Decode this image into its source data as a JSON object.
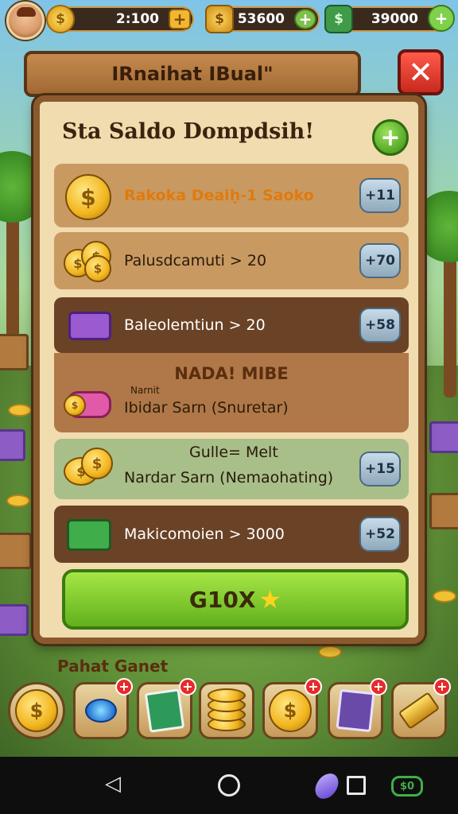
{
  "topbar": {
    "coins_value": "2:100",
    "coins_icon": "coin-icon",
    "gold_value": "53600",
    "gold_icon": "gold-bag-icon",
    "cash_value": "39000",
    "cash_icon": "cash-icon"
  },
  "dialog": {
    "title": "IRnaihat IBual\"",
    "close_label": "✕",
    "heading": "Sta Saldo Dompdsih!",
    "add_label": "+",
    "items": [
      {
        "label": "Rakoka Deaiḥ-1 Saoko",
        "badge": "+11",
        "icon": "coin-icon"
      },
      {
        "label": "Palusdcamuti  >  20",
        "badge": "+70",
        "icon": "coin-stack-icon"
      },
      {
        "label": "Baleolemtiun  >  20",
        "badge": "+58",
        "icon": "chest-icon"
      },
      {
        "label": "Ibidar Sarn (Snuretar)",
        "badge": "",
        "icon": "gift-roll-icon",
        "header": "NADA! MIBE",
        "sub": "Narnit"
      },
      {
        "label": "Nardar Sarn (Nemaohating)",
        "badge": "+15",
        "icon": "coin-pile-icon",
        "header": "Gulle= Melt"
      },
      {
        "label": "Makicomoien  >  3000",
        "badge": "+52",
        "icon": "cash-box-icon"
      }
    ],
    "confirm_label": "G10X",
    "confirm_icon": "star-icon"
  },
  "bottom": {
    "label": "Pahat Ganet",
    "tray": [
      {
        "icon": "coin-icon",
        "badge": ""
      },
      {
        "icon": "blue-crystal-icon",
        "badge": "+"
      },
      {
        "icon": "card-icon",
        "badge": "+"
      },
      {
        "icon": "coin-stack-icon",
        "badge": ""
      },
      {
        "icon": "coin-icon",
        "badge": "+"
      },
      {
        "icon": "cards-icon",
        "badge": "+"
      },
      {
        "icon": "gold-bar-icon",
        "badge": "+"
      }
    ]
  },
  "navbar": {
    "back_glyph": "◁",
    "cash_label": "$0"
  },
  "colors": {
    "accent": "#62b01c",
    "frame": "#8a5a2e",
    "close": "#c82a1e"
  }
}
